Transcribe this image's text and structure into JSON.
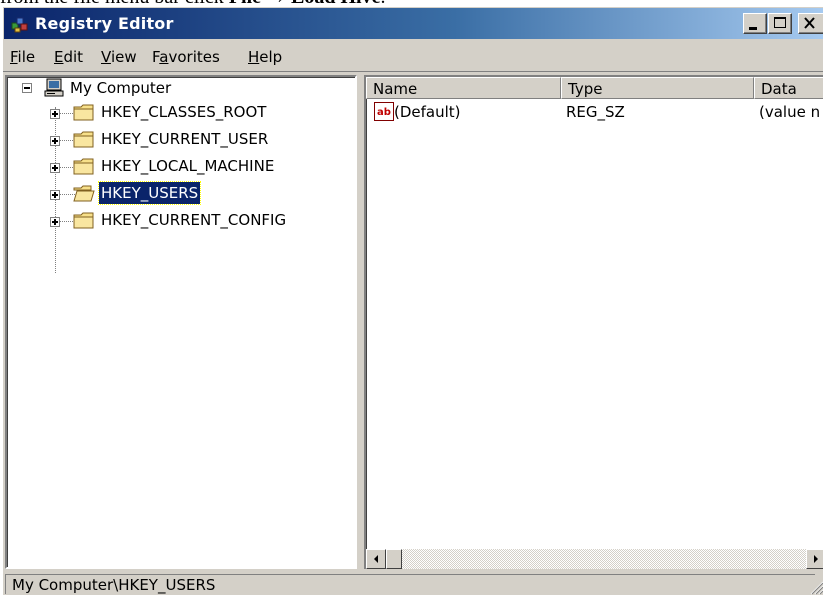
{
  "caption": {
    "prefix": "from the file menu bar click ",
    "bold_text": "File → Load Hive",
    "suffix": "."
  },
  "window": {
    "title": "Registry Editor",
    "controls": [
      "minimize-icon",
      "maximize-icon",
      "close-icon"
    ]
  },
  "menu": {
    "items": [
      {
        "label": "File",
        "accel": "F",
        "rest": "ile"
      },
      {
        "label": "Edit",
        "accel": "E",
        "rest": "dit"
      },
      {
        "label": "View",
        "accel": "V",
        "rest": "iew"
      },
      {
        "label": "Favorites",
        "accel": "a",
        "pre": "F",
        "rest": "vorites"
      },
      {
        "label": "Help",
        "accel": "H",
        "rest": "elp"
      }
    ]
  },
  "tree": {
    "root": {
      "label": "My Computer",
      "icon": "computer-icon",
      "expander": "minus"
    },
    "children": [
      {
        "label": "HKEY_CLASSES_ROOT",
        "icon": "folder-icon",
        "expander": "plus",
        "selected": false
      },
      {
        "label": "HKEY_CURRENT_USER",
        "icon": "folder-icon",
        "expander": "plus",
        "selected": false
      },
      {
        "label": "HKEY_LOCAL_MACHINE",
        "icon": "folder-icon",
        "expander": "plus",
        "selected": false
      },
      {
        "label": "HKEY_USERS",
        "icon": "open-folder-icon",
        "expander": "plus",
        "selected": true
      },
      {
        "label": "HKEY_CURRENT_CONFIG",
        "icon": "folder-icon",
        "expander": "plus",
        "selected": false
      }
    ]
  },
  "list": {
    "columns": [
      "Name",
      "Type",
      "Data"
    ],
    "rows": [
      {
        "icon": "string-value-icon",
        "name": "(Default)",
        "type": "REG_SZ",
        "data": "(value n"
      }
    ]
  },
  "status": {
    "path": "My Computer\\HKEY_USERS"
  },
  "colors": {
    "title_start": "#0a246a",
    "title_end": "#a6caf0",
    "face": "#d4d0c8",
    "selection": "#0a246a"
  }
}
